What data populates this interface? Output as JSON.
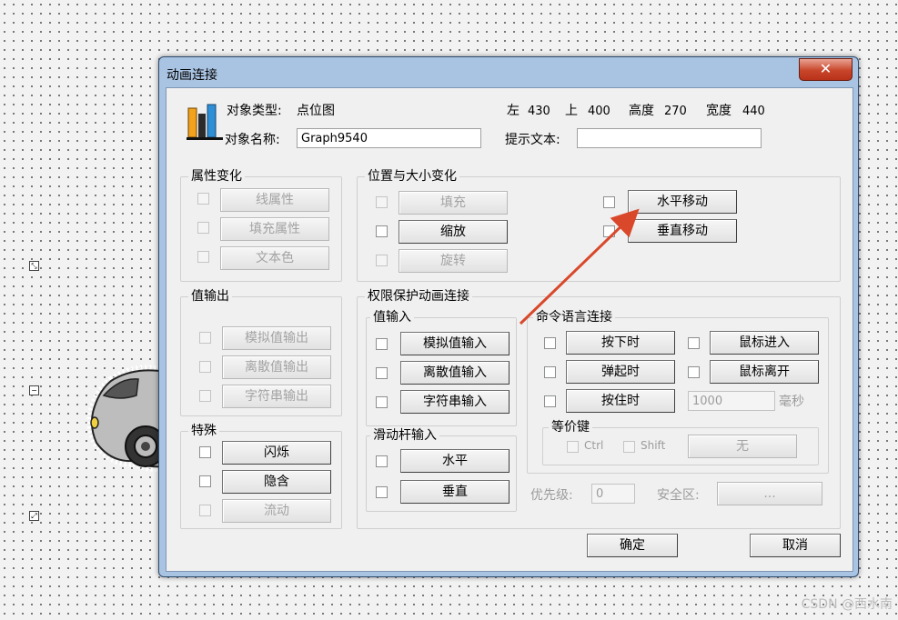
{
  "canvas": {
    "handles": [
      "resize-icon",
      "minus-icon",
      "resize-icon"
    ]
  },
  "dialog": {
    "title": "动画连接",
    "close_glyph": "✕",
    "object": {
      "type_label": "对象类型:",
      "type_value": "点位图",
      "name_label": "对象名称:",
      "name_value": "Graph9540",
      "left_label": "左",
      "left_value": "430",
      "top_label": "上",
      "top_value": "400",
      "height_label": "高度",
      "height_value": "270",
      "width_label": "宽度",
      "width_value": "440",
      "hint_label": "提示文本:",
      "hint_value": ""
    },
    "attr_group": {
      "title": "属性变化",
      "items": [
        "线属性",
        "填充属性",
        "文本色"
      ]
    },
    "pos_group": {
      "title": "位置与大小变化",
      "left_items": [
        "填充",
        "缩放",
        "旋转"
      ],
      "right_items": [
        "水平移动",
        "垂直移动"
      ]
    },
    "value_out_group": {
      "title": "值输出",
      "items": [
        "模拟值输出",
        "离散值输出",
        "字符串输出"
      ]
    },
    "special_group": {
      "title": "特殊",
      "items": [
        "闪烁",
        "隐含",
        "流动"
      ]
    },
    "perm_group": {
      "title": "权限保护动画连接",
      "value_in": {
        "title": "值输入",
        "items": [
          "模拟值输入",
          "离散值输入",
          "字符串输入"
        ]
      },
      "slider": {
        "title": "滑动杆输入",
        "items": [
          "水平",
          "垂直"
        ]
      },
      "command": {
        "title": "命令语言连接",
        "left_items": [
          "按下时",
          "弹起时",
          "按住时"
        ],
        "right_items": [
          "鼠标进入",
          "鼠标离开"
        ],
        "hold_ms_value": "1000",
        "ms_unit": "毫秒",
        "equiv": {
          "title": "等价键",
          "ctrl": "Ctrl",
          "shift": "Shift",
          "key_button": "无"
        }
      },
      "priority_label": "优先级:",
      "priority_value": "0",
      "security_label": "安全区:",
      "security_button": "..."
    },
    "ok_label": "确定",
    "cancel_label": "取消"
  },
  "annotation": {
    "arrow_color": "#d9482b"
  },
  "watermark": "CSDN @西水南"
}
